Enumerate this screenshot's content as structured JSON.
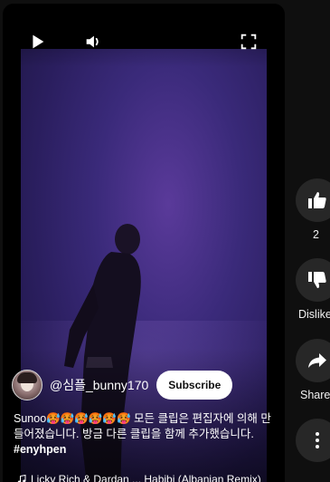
{
  "player": {
    "controls": {
      "play_icon": "play-icon",
      "volume_icon": "volume-icon",
      "fullscreen_icon": "fullscreen-icon"
    }
  },
  "channel": {
    "name": "@심플_bunny170",
    "subscribe_label": "Subscribe"
  },
  "description": {
    "text": "Sunoo🥵🥵🥵🥵🥵🥵 모든 클립은 편집자에 의해 만들어졌습니다. 방금 다른 클립을 함께 추가했습니다. ",
    "hashtag": "#enyhpen"
  },
  "music": {
    "icon": "music-note-icon",
    "text": "Licky Rich & Dardan ... Habibi (Albanian Remix)"
  },
  "actions": {
    "like": {
      "icon": "thumbs-up-icon",
      "label": "2"
    },
    "dislike": {
      "icon": "thumbs-down-icon",
      "label": "Dislike"
    },
    "share": {
      "icon": "share-icon",
      "label": "Share"
    },
    "more": {
      "icon": "more-vertical-icon"
    }
  },
  "colors": {
    "background": "#0f0f0f",
    "action_button": "#272727",
    "subscribe_bg": "#ffffff",
    "video_tint": "#3a2a7a"
  }
}
